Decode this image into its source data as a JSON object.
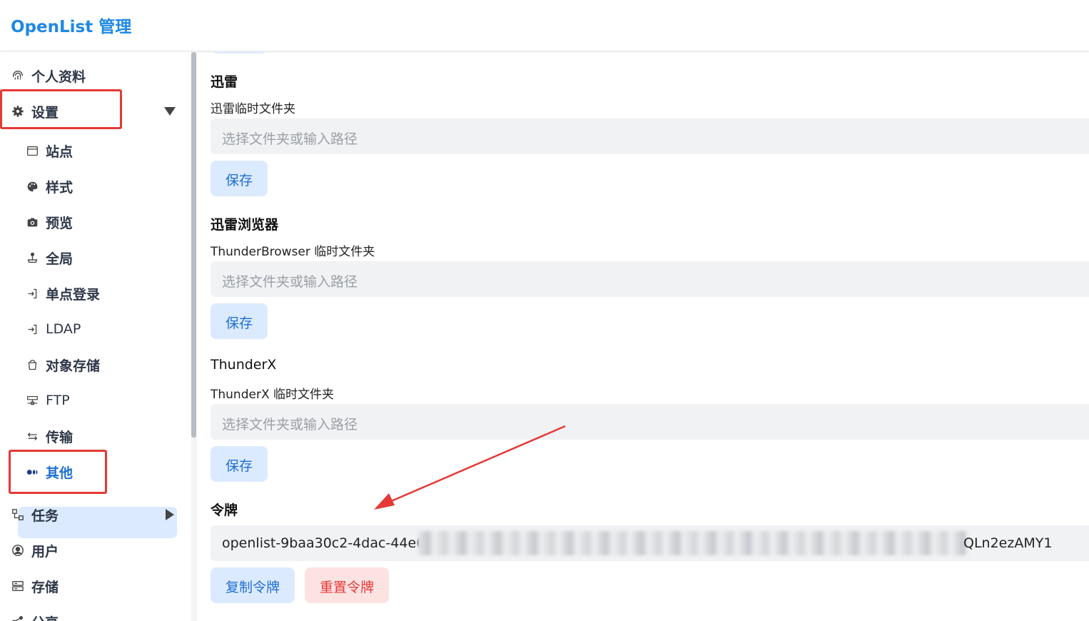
{
  "header": {
    "brand": "OpenList 管理"
  },
  "sidebar": {
    "profile": "个人资料",
    "settings": "设置",
    "sub_items": [
      "站点",
      "样式",
      "预览",
      "全局",
      "单点登录",
      "LDAP",
      "对象存储",
      "FTP",
      "传输",
      "其他"
    ],
    "tasks": "任务",
    "users": "用户",
    "storage": "存储",
    "share": "分享"
  },
  "main": {
    "sections": [
      {
        "title": "迅雷",
        "label": "迅雷临时文件夹",
        "placeholder": "选择文件夹或输入路径",
        "save": "保存"
      },
      {
        "title": "迅雷浏览器",
        "label": "ThunderBrowser 临时文件夹",
        "placeholder": "选择文件夹或输入路径",
        "save": "保存"
      },
      {
        "title": "ThunderX",
        "label": "ThunderX 临时文件夹",
        "placeholder": "选择文件夹或输入路径",
        "save": "保存"
      }
    ],
    "token": {
      "title": "令牌",
      "value_visible_start": "openlist-9baa30c2-4dac-44e6",
      "value_visible_end": "QLn2ezAMY1",
      "copy_button": "复制令牌",
      "reset_button": "重置令牌"
    }
  },
  "colors": {
    "accent": "#1e88e5",
    "danger": "#e53935",
    "annotation": "#e53935"
  }
}
